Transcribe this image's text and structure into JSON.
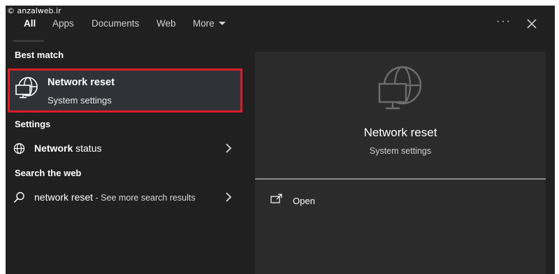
{
  "watermark": "© anzalweb.ir",
  "tabs": [
    {
      "label": "All"
    },
    {
      "label": "Apps"
    },
    {
      "label": "Documents"
    },
    {
      "label": "Web"
    },
    {
      "label": "More"
    }
  ],
  "topbar": {
    "more_options": "···"
  },
  "sections": {
    "best_match": "Best match",
    "settings": "Settings",
    "search_web": "Search the web"
  },
  "best_match": {
    "title": "Network reset",
    "subtitle": "System settings",
    "icon": "globe-monitor-icon",
    "highlight_color": "#d81e2a"
  },
  "settings_items": [
    {
      "bold": "Network",
      "rest": " status",
      "icon": "globe-icon"
    }
  ],
  "web_items": [
    {
      "query": "network reset",
      "suffix": " - See more search results",
      "icon": "search-icon"
    }
  ],
  "detail": {
    "title": "Network reset",
    "subtitle": "System settings",
    "open_label": "Open",
    "icon": "globe-monitor-icon"
  },
  "colors": {
    "background": "#202020",
    "panel": "#2b2b2b",
    "selected": "#2f3338"
  }
}
